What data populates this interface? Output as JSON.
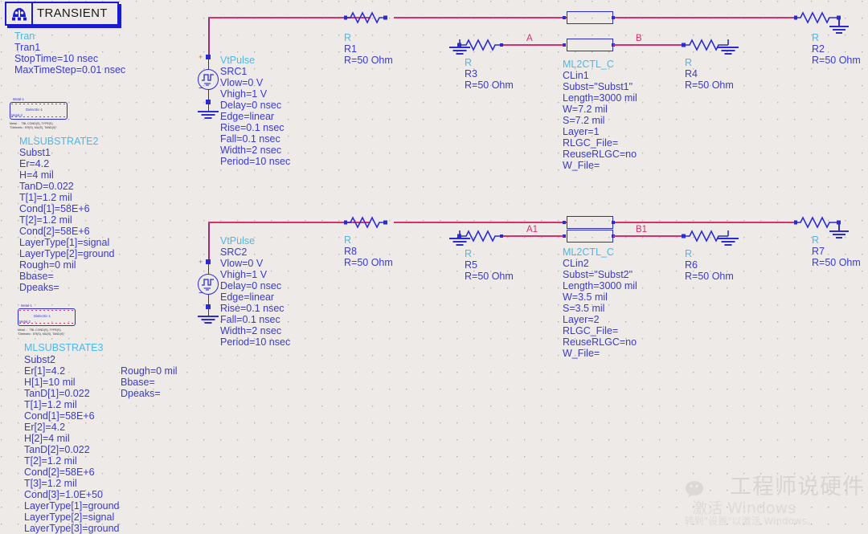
{
  "app": {
    "background_color": "#edeae8",
    "wire_blue": "#2b2bd4",
    "wire_pink": "#d6306f",
    "type_color": "#4db8e8",
    "param_color": "#3a3ad0"
  },
  "transient": {
    "title": "TRANSIENT",
    "icon": "transient-gear-icon",
    "type": "Tran",
    "instance": "Tran1",
    "params": [
      "StopTime=10 nsec",
      "MaxTimeStep=0.01 nsec"
    ]
  },
  "substrate1": {
    "icon_top_label": "Metal-1",
    "icon_mid_label": "Dielectric-1",
    "icon_bot_label": "Metal-2",
    "icon_note1": "Metal :    TBL COND(S), TYPE(S)",
    "icon_note2": "\"Dielectric : ER(S), MU(S), TAND(S)\"",
    "type": "MLSUBSTRATE2",
    "instance": "Subst1",
    "params": [
      "Er=4.2",
      "H=4 mil",
      "TanD=0.022",
      "T[1]=1.2 mil",
      "Cond[1]=58E+6",
      "T[2]=1.2 mil",
      "Cond[2]=58E+6",
      "LayerType[1]=signal",
      "LayerType[2]=ground",
      "Rough=0 mil",
      "Bbase=",
      "Dpeaks="
    ]
  },
  "substrate2": {
    "icon_top_label": "Metal-1",
    "icon_mid_label": "Dielectric-1",
    "icon_bot_label": "Metal-2",
    "icon_note1": "Metal :    TBL COND(S), TYPE(S)",
    "icon_note2": "\"Dielectric : ER(S), MU(S), TAND(S)\"",
    "type": "MLSUBSTRATE3",
    "instance": "Subst2",
    "params_col1": [
      "Er[1]=4.2",
      "H[1]=10 mil",
      "TanD[1]=0.022",
      "T[1]=1.2 mil",
      "Cond[1]=58E+6",
      "Er[2]=4.2",
      "H[2]=4 mil",
      "TanD[2]=0.022",
      "T[2]=1.2 mil",
      "Cond[2]=58E+6",
      "T[3]=1.2 mil",
      "Cond[3]=1.0E+50",
      "LayerType[1]=ground",
      "LayerType[2]=signal",
      "LayerType[3]=ground"
    ],
    "params_col2": [
      "Rough=0 mil",
      "Bbase=",
      "Dpeaks="
    ]
  },
  "source1": {
    "type": "VtPulse",
    "instance": "SRC1",
    "plus": "+",
    "minus": "−",
    "params": [
      "Vlow=0 V",
      "Vhigh=1 V",
      "Delay=0 nsec",
      "Edge=linear",
      "Rise=0.1 nsec",
      "Fall=0.1 nsec",
      "Width=2 nsec",
      "Period=10 nsec"
    ]
  },
  "source2": {
    "type": "VtPulse",
    "instance": "SRC2",
    "plus": "+",
    "minus": "−",
    "params": [
      "Vlow=0 V",
      "Vhigh=1 V",
      "Delay=0 nsec",
      "Edge=linear",
      "Rise=0.1 nsec",
      "Fall=0.1 nsec",
      "Width=2 nsec",
      "Period=10 nsec"
    ]
  },
  "clin1": {
    "type": "ML2CTL_C",
    "instance": "CLin1",
    "params": [
      "Subst=\"Subst1\"",
      "Length=3000 mil",
      "W=7.2 mil",
      "S=7.2 mil",
      "Layer=1",
      "RLGC_File=",
      "ReuseRLGC=no",
      "W_File="
    ]
  },
  "clin2": {
    "type": "ML2CTL_C",
    "instance": "CLin2",
    "params": [
      "Subst=\"Subst2\"",
      "Length=3000 mil",
      "W=3.5 mil",
      "S=3.5 mil",
      "Layer=2",
      "RLGC_File=",
      "ReuseRLGC=no",
      "W_File="
    ]
  },
  "resistors": [
    {
      "id": "r1",
      "type": "R",
      "instance": "R1",
      "value": "R=50 Ohm"
    },
    {
      "id": "r2",
      "type": "R",
      "instance": "R2",
      "value": "R=50 Ohm"
    },
    {
      "id": "r3",
      "type": "R",
      "instance": "R3",
      "value": "R=50 Ohm"
    },
    {
      "id": "r4",
      "type": "R",
      "instance": "R4",
      "value": "R=50 Ohm"
    },
    {
      "id": "r5",
      "type": "R",
      "instance": "R5",
      "value": "R=50 Ohm"
    },
    {
      "id": "r6",
      "type": "R",
      "instance": "R6",
      "value": "R=50 Ohm"
    },
    {
      "id": "r7",
      "type": "R",
      "instance": "R7",
      "value": "R=50 Ohm"
    },
    {
      "id": "r8",
      "type": "R",
      "instance": "R8",
      "value": "R=50 Ohm"
    }
  ],
  "nodes": {
    "a": "A",
    "b": "B",
    "a1": "A1",
    "b1": "B1"
  },
  "watermark": {
    "text": "工程师说硬件",
    "icon": "wechat-icon",
    "activate_line1": "激活 Windows",
    "activate_line2": "转到\"设置\"以激活 Windows。"
  }
}
